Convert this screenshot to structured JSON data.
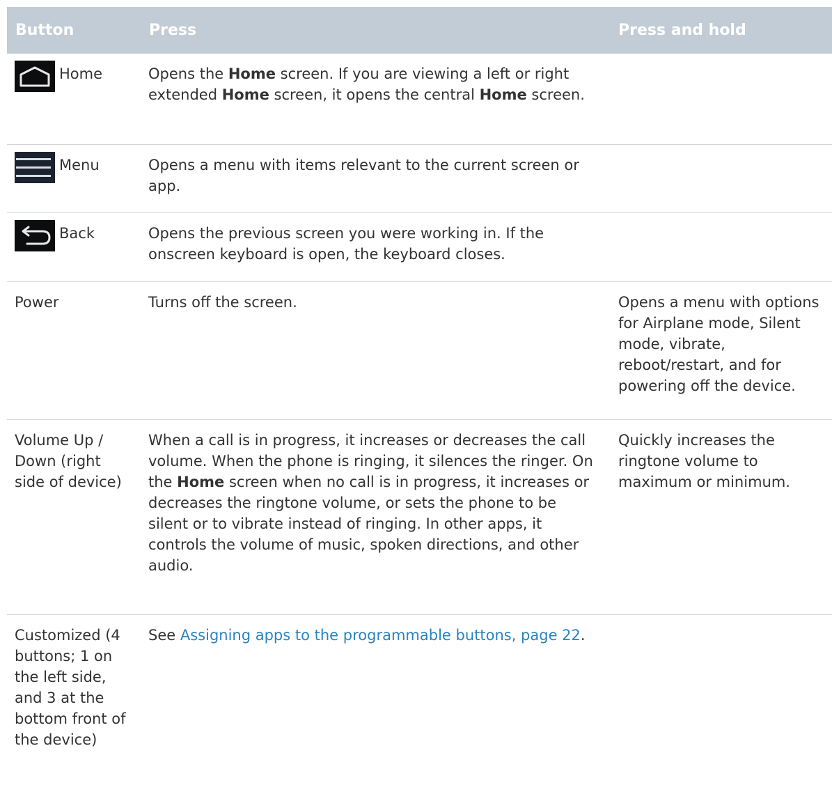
{
  "table": {
    "headers": {
      "button": "Button",
      "press": "Press",
      "hold": "Press and hold"
    },
    "rows": {
      "home": {
        "button_label": "Home",
        "icon": "home-key-icon",
        "press": {
          "p1": "Opens the ",
          "b1": "Home",
          "p2": " screen. If you are viewing a left or right extended ",
          "b2": "Home",
          "p3": " screen, it opens the central ",
          "b3": "Home",
          "p4": " screen."
        },
        "hold": ""
      },
      "menu": {
        "button_label": "Menu",
        "icon": "menu-key-icon",
        "press": "Opens a menu with items relevant to the current screen or app.",
        "hold": ""
      },
      "back": {
        "button_label": "Back",
        "icon": "back-key-icon",
        "press": "Opens the previous screen you were working in. If the onscreen keyboard is open, the keyboard closes.",
        "hold": ""
      },
      "power": {
        "button_label": "Power",
        "press": "Turns off the screen.",
        "hold": "Opens a menu with options for Airplane mode, Silent mode, vibrate, reboot/restart, and for powering off the device."
      },
      "volume": {
        "button_label": "Volume Up / Down (right side of device)",
        "press": {
          "p1": "When a call is in progress, it increases or decreases the call volume. When the phone is ringing, it silences the ringer. On the ",
          "b1": "Home",
          "p2": " screen when no call is in progress, it increases or decreases the ringtone volume, or sets the phone to be silent or to vibrate instead of ringing. In other apps, it controls the volume of music, spoken directions, and other audio."
        },
        "hold": "Quickly increases the ringtone volume to maximum or minimum."
      },
      "custom": {
        "button_label": "Customized (4 buttons; 1 on the left side, and 3 at the bottom front of the device)",
        "press": {
          "p1": "See ",
          "link": "Assigning apps to the programmable buttons, page 22",
          "p2": "."
        },
        "hold": ""
      }
    }
  },
  "colors": {
    "header_bg": "#c2ccd6",
    "link": "#2a84c0",
    "text": "#333333",
    "divider": "#d2d5d8"
  }
}
